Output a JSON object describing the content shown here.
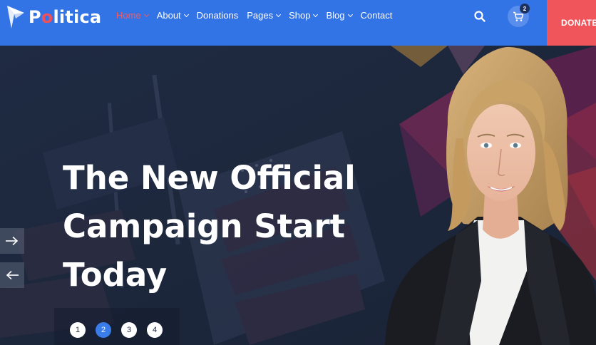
{
  "header": {
    "brand": {
      "part1": "P",
      "accent": "o",
      "part2": "litica"
    },
    "nav": [
      {
        "label": "Home",
        "dropdown": true,
        "active": true
      },
      {
        "label": "About",
        "dropdown": true,
        "active": false
      },
      {
        "label": "Donations",
        "dropdown": false,
        "active": false
      },
      {
        "label": "Pages",
        "dropdown": true,
        "active": false
      },
      {
        "label": "Shop",
        "dropdown": true,
        "active": false
      },
      {
        "label": "Blog",
        "dropdown": true,
        "active": false
      },
      {
        "label": "Contact",
        "dropdown": false,
        "active": false
      }
    ],
    "cart_count": "2",
    "donate_label": "DONATE",
    "icons": {
      "search": "search-icon",
      "cart": "cart-icon"
    }
  },
  "hero": {
    "headline": [
      "The New Official",
      "Campaign Start",
      "Today"
    ],
    "slides": [
      "1",
      "2",
      "3",
      "4"
    ],
    "active_slide": 2
  },
  "colors": {
    "header_bg": "#3273e6",
    "accent_red": "#f0555b",
    "hero_bg": "#1e2a40",
    "active_dot": "#3a7ce8"
  }
}
